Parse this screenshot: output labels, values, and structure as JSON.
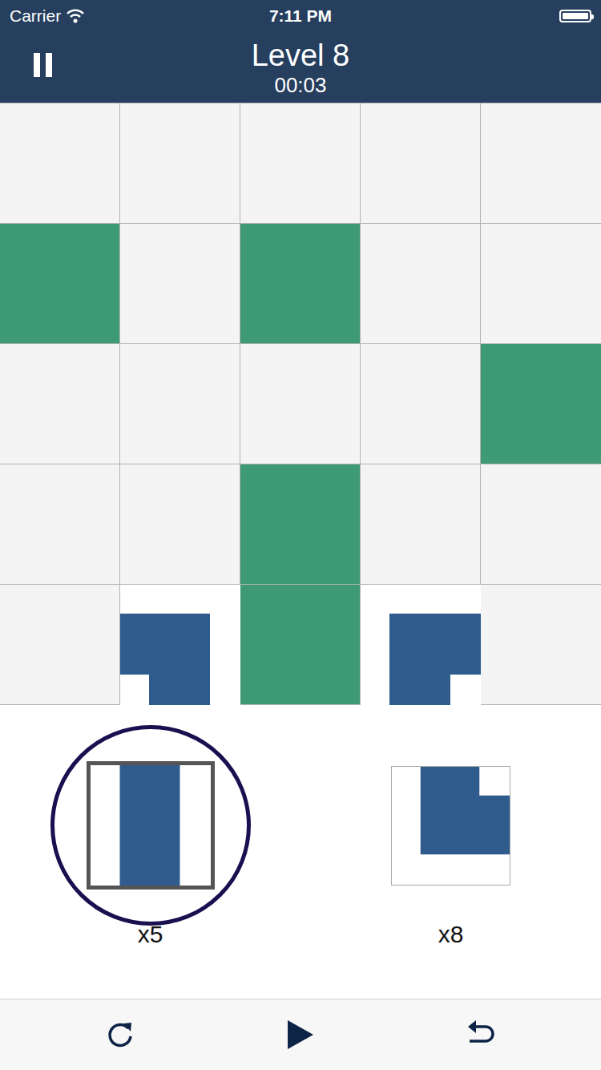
{
  "status_bar": {
    "carrier": "Carrier",
    "time": "7:11 PM",
    "battery_level": 1
  },
  "header": {
    "title": "Level 8",
    "timer": "00:03"
  },
  "grid": {
    "rows": [
      {
        "cells": [
          {
            "kind": "empty"
          },
          {
            "kind": "empty"
          },
          {
            "kind": "empty"
          },
          {
            "kind": "empty"
          },
          {
            "kind": "empty"
          }
        ]
      },
      {
        "cells": [
          {
            "kind": "wall"
          },
          {
            "kind": "empty"
          },
          {
            "kind": "wall"
          },
          {
            "kind": "empty"
          },
          {
            "kind": "empty"
          }
        ]
      },
      {
        "cells": [
          {
            "kind": "empty"
          },
          {
            "kind": "empty"
          },
          {
            "kind": "empty"
          },
          {
            "kind": "empty"
          },
          {
            "kind": "wall"
          }
        ]
      },
      {
        "cells": [
          {
            "kind": "empty"
          },
          {
            "kind": "empty"
          },
          {
            "kind": "wall"
          },
          {
            "kind": "empty"
          },
          {
            "kind": "empty"
          }
        ]
      },
      {
        "cells": [
          {
            "kind": "empty"
          },
          {
            "kind": "bendwest"
          },
          {
            "kind": "wall"
          },
          {
            "kind": "bendeast"
          },
          {
            "kind": "empty"
          }
        ]
      }
    ]
  },
  "tray": {
    "items": [
      {
        "kind": "straight",
        "count": "x5",
        "selected": true
      },
      {
        "kind": "bendnorth",
        "count": "x8",
        "selected": false
      }
    ]
  }
}
